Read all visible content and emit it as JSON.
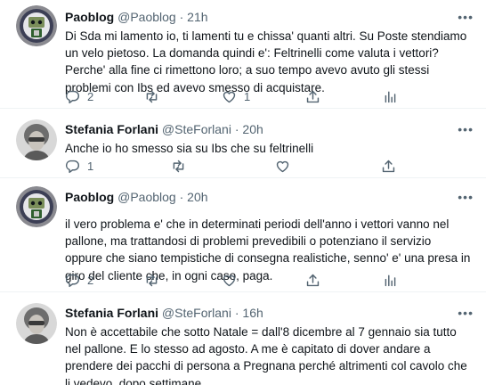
{
  "tweets": [
    {
      "name": "Paoblog",
      "handle": "@Paoblog",
      "separator": "·",
      "time": "21h",
      "text": "Di Sda mi lamento io, ti lamenti tu e chissa' quanti altri. Su Poste stendiamo\nun velo pietoso. La domanda quindi e': Feltrinelli come valuta i vettori?\nPerche' alla fine ci rimettono loro; a suo tempo avevo avuto  gli stessi\nproblemi con Ibs ed avevo smesso di acquistare.",
      "reply_count": "2",
      "retweet_count": "",
      "like_count": "1",
      "avatar_icon": "blogger-avatar-icon"
    },
    {
      "name": "Stefania Forlani",
      "handle": "@SteForlani",
      "separator": "·",
      "time": "20h",
      "text": "Anche io ho smesso sia su Ibs che su feltrinelli",
      "reply_count": "1",
      "retweet_count": "",
      "like_count": "",
      "avatar_icon": "woman-portrait-avatar-icon"
    },
    {
      "name": "Paoblog",
      "handle": "@Paoblog",
      "separator": "·",
      "time": "20h",
      "text": "il vero problema e' che in determinati periodi dell'anno i vettori vanno nel\npallone, ma trattandosi di problemi prevedibili o potenziano il servizio\noppure che siano tempistiche di consegna realistiche, senno' e' una presa in\ngiro del cliente che, in ogni caso, paga.",
      "reply_count": "2",
      "retweet_count": "",
      "like_count": "",
      "avatar_icon": "blogger-avatar-icon"
    },
    {
      "name": "Stefania Forlani",
      "handle": "@SteForlani",
      "separator": "·",
      "time": "16h",
      "text": "Non è accettabile che sotto Natale = dall'8 dicembre al 7 gennaio sia tutto\nnel pallone. E lo stesso ad agosto. A me è capitato di dover andare a\nprendere dei pacchi di persona a Pregnana perché altrimenti col cavolo che\nli vedevo, dopo settimane.",
      "reply_count": "",
      "retweet_count": "",
      "like_count": "",
      "avatar_icon": "woman-portrait-avatar-icon"
    }
  ],
  "icons": {
    "more": "more-dots-icon",
    "reply": "reply-icon",
    "retweet": "retweet-icon",
    "like": "heart-icon",
    "share": "share-icon",
    "analytics": "analytics-icon"
  },
  "colors": {
    "text": "#0f1419",
    "secondary": "#536471",
    "border": "#eff3f4",
    "thread_line": "#cfd9de"
  }
}
